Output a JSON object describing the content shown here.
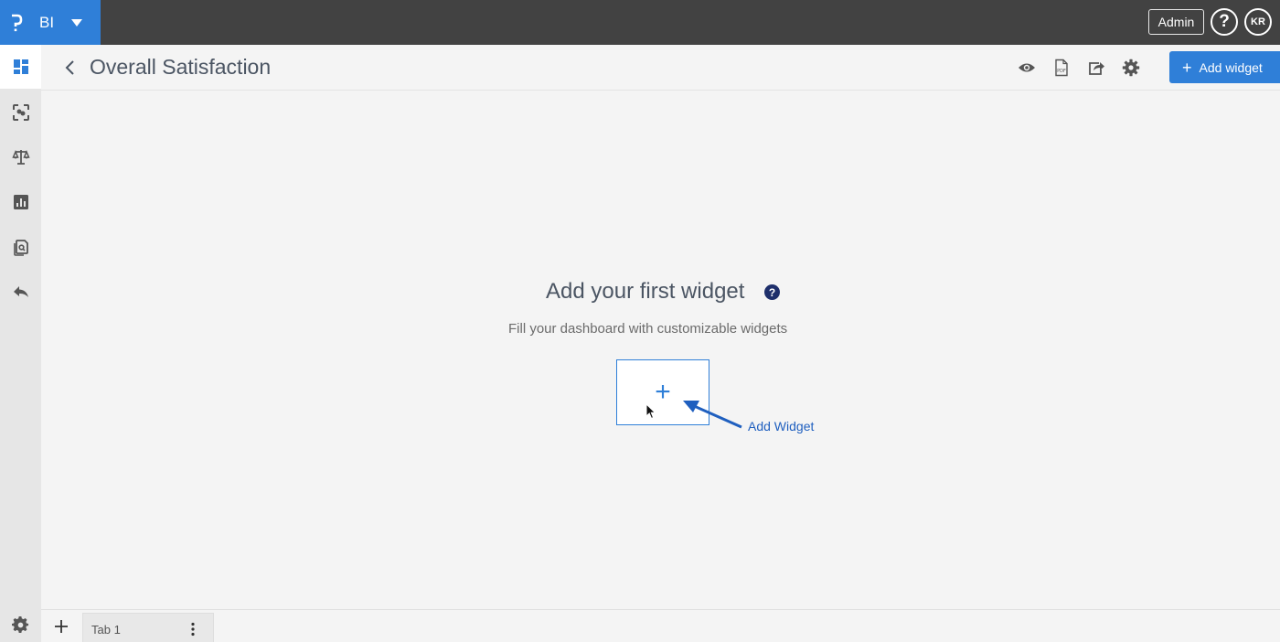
{
  "brand": {
    "name": "BI"
  },
  "topbar": {
    "admin_label": "Admin",
    "help_label": "?",
    "avatar_initials": "KR"
  },
  "sidebar": {
    "items": [
      {
        "icon": "dashboard-icon",
        "active": true
      },
      {
        "icon": "scan-icon",
        "active": false
      },
      {
        "icon": "balance-scale-icon",
        "active": false
      },
      {
        "icon": "bar-chart-icon",
        "active": false
      },
      {
        "icon": "copy-search-icon",
        "active": false
      },
      {
        "icon": "reply-icon",
        "active": false
      }
    ],
    "bottom_icon": "gear-icon"
  },
  "header": {
    "title": "Overall Satisfaction",
    "icons": [
      "eye-icon",
      "pdf-icon",
      "share-icon",
      "gear-icon"
    ],
    "add_widget_label": "Add widget",
    "add_widget_plus": "+"
  },
  "empty_state": {
    "title": "Add your first widget",
    "help_badge": "?",
    "subtitle": "Fill your dashboard with customizable widgets",
    "add_plus": "+",
    "annotation": "Add Widget"
  },
  "tabs": {
    "add_label": "+",
    "items": [
      {
        "label": "Tab 1"
      }
    ]
  },
  "colors": {
    "accent": "#2f7fd8",
    "topbar": "#424242",
    "annotation": "#1f5fbf"
  }
}
